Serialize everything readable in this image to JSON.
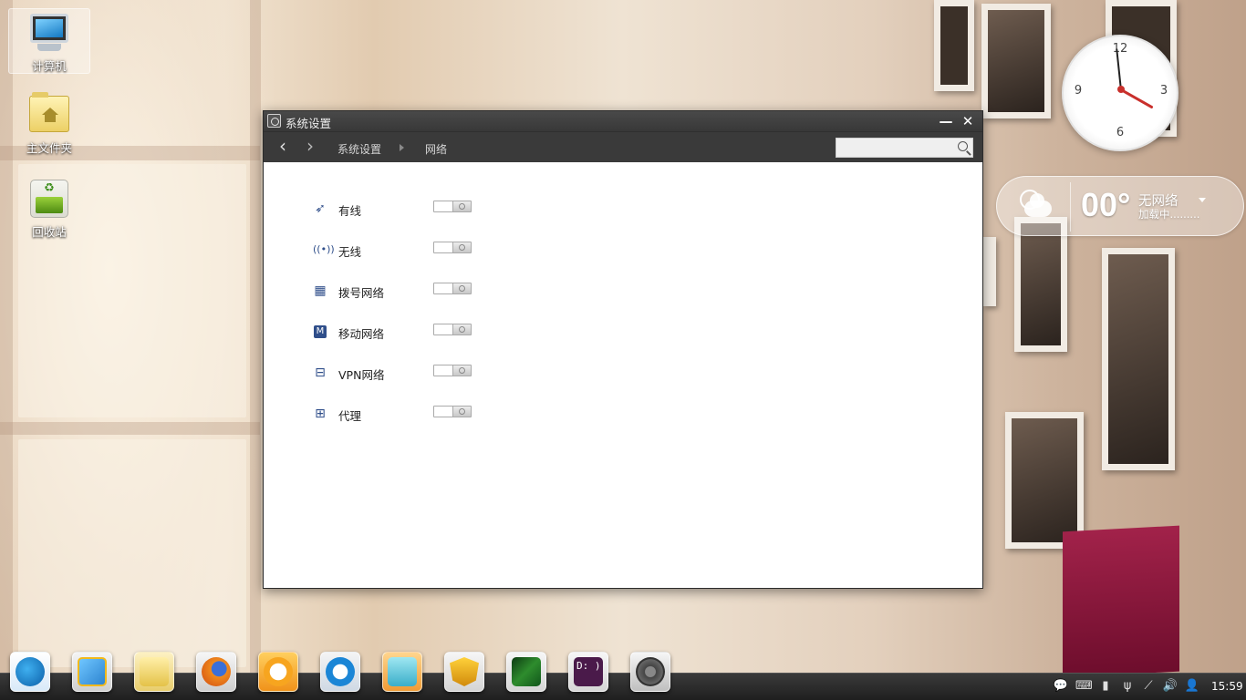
{
  "desktop": {
    "icons": [
      {
        "label": "计算机"
      },
      {
        "label": "主文件夹"
      },
      {
        "label": "回收站"
      }
    ]
  },
  "window": {
    "title": "系统设置",
    "breadcrumb": [
      "系统设置",
      "网络"
    ],
    "search": {
      "value": "",
      "placeholder": ""
    },
    "network_items": [
      {
        "label": "有线",
        "icon": "wired-icon",
        "enabled": false
      },
      {
        "label": "无线",
        "icon": "wireless-icon",
        "enabled": false
      },
      {
        "label": "拨号网络",
        "icon": "dialup-icon",
        "enabled": false
      },
      {
        "label": "移动网络",
        "icon": "mobile-network-icon",
        "enabled": false
      },
      {
        "label": "VPN网络",
        "icon": "vpn-icon",
        "enabled": false
      },
      {
        "label": "代理",
        "icon": "proxy-icon",
        "enabled": false
      }
    ]
  },
  "clock": {
    "numerals": [
      "12",
      "3",
      "6",
      "9"
    ],
    "hour": 3,
    "minute": 59
  },
  "weather": {
    "temperature": "00°",
    "city": "无网络",
    "status": "加载中........."
  },
  "dock": {
    "apps": [
      "deepin-launcher",
      "desktop-manager",
      "file-manager",
      "firefox",
      "music-player",
      "deepin-store",
      "gift-bag",
      "game-center",
      "image-viewer",
      "terminal",
      "system-settings"
    ],
    "terminal_glyph": "D: )"
  },
  "tray": {
    "time": "15:59"
  },
  "colors": {
    "accent": "#2f4e8a",
    "titlebar": "#3a3a3a",
    "shelf": "#a2224a"
  }
}
